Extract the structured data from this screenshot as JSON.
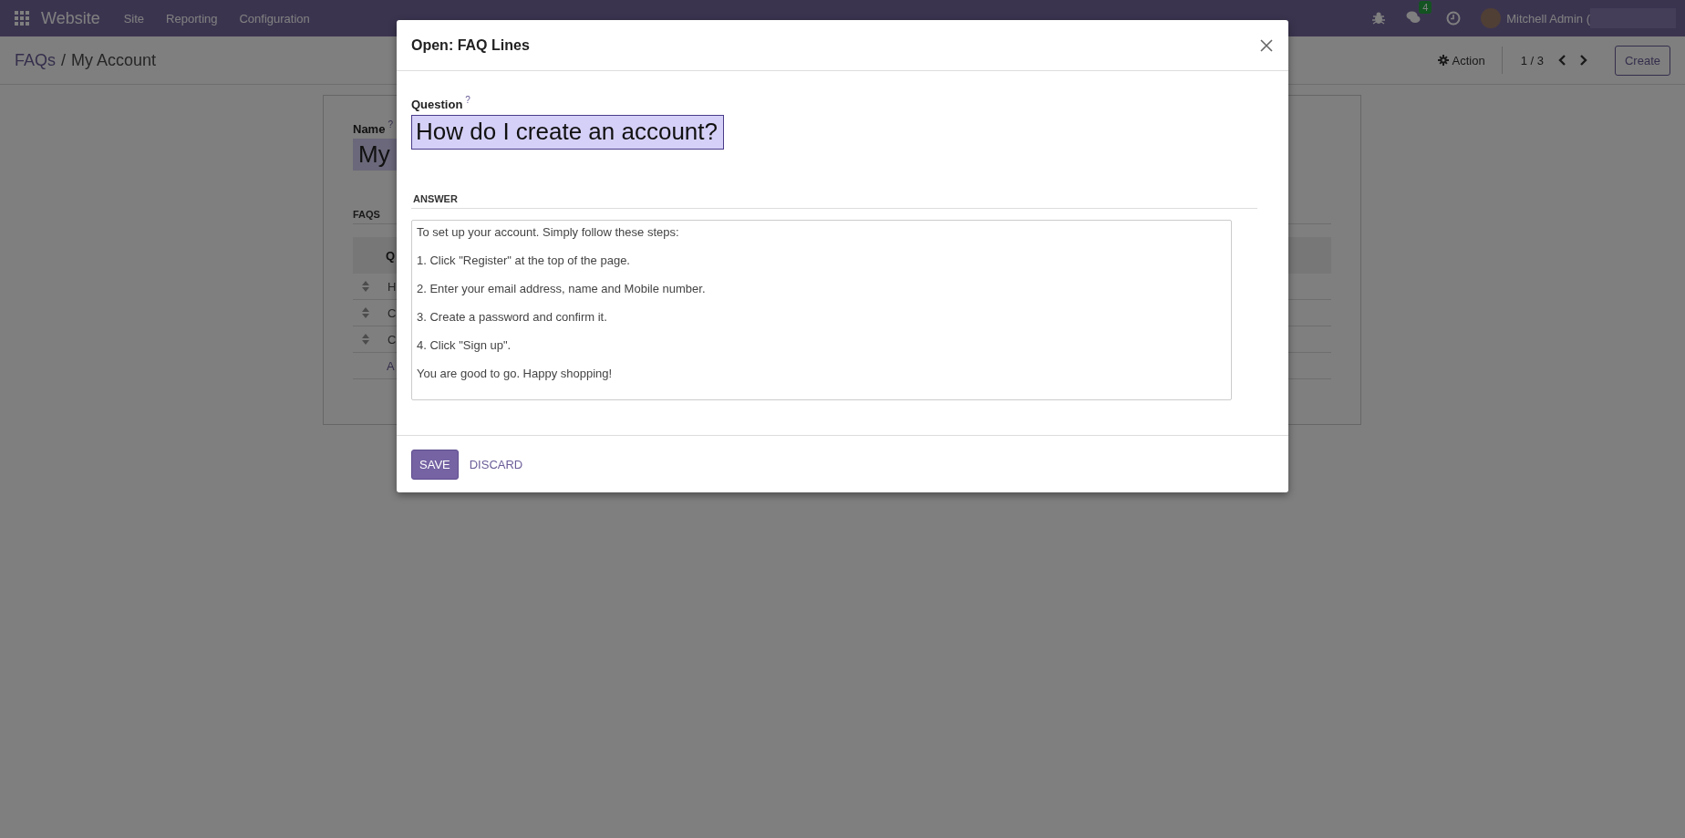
{
  "navbar": {
    "app_name": "Website",
    "menus": [
      "Site",
      "Reporting",
      "Configuration"
    ],
    "message_count": "4",
    "user": "Mitchell Admin ("
  },
  "breadcrumb": {
    "items": [
      "FAQs",
      "My Account"
    ],
    "separator": "/"
  },
  "control_panel": {
    "action": "Action",
    "pager": "1 / 3",
    "create": "Create"
  },
  "form": {
    "name_label": "Name",
    "name_help": "?",
    "name_value": "My",
    "section": "FAQS",
    "table": {
      "column_1": "Q",
      "rows": [
        "H",
        "C",
        "C"
      ],
      "add_line": "A"
    }
  },
  "dialog": {
    "title": "Open: FAQ Lines",
    "question_label": "Question",
    "question_help": "?",
    "question_value": "How do I create an account?",
    "answer_heading": "ANSWER",
    "answer_lines": [
      "To set up your account. Simply follow these steps:",
      "1. Click \"Register\" at the top of the page.",
      "2. Enter your email address, name and Mobile number.",
      "3. Create a password and confirm it.",
      "4. Click \"Sign up\".",
      "You are good to go. Happy shopping!"
    ],
    "buttons": [
      {
        "label": "SAVE",
        "kind": "primary"
      },
      {
        "label": "DISCARD",
        "kind": "link"
      }
    ]
  }
}
